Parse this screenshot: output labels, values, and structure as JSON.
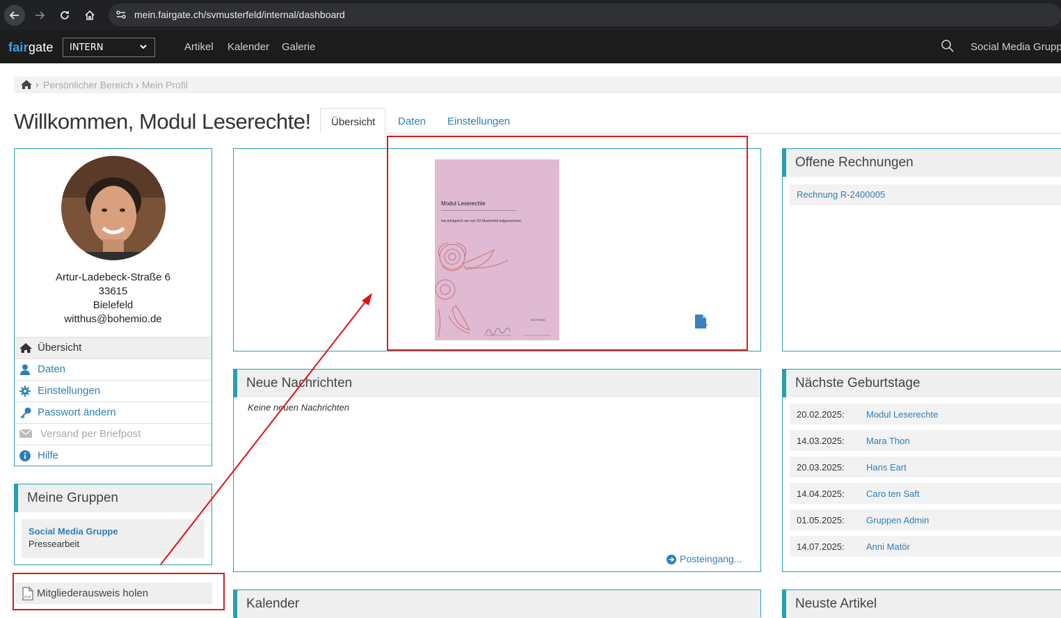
{
  "browser": {
    "url": "mein.fairgate.ch/svmusterfeld/internal/dashboard"
  },
  "nav": {
    "logo_a": "fair",
    "logo_b": "gate",
    "area_select": "INTERN",
    "menu": [
      "Artikel",
      "Kalender",
      "Galerie"
    ],
    "group_label": "Social Media Gruppe"
  },
  "breadcrumb": [
    "Persönlicher Bereich",
    "Mein Profil"
  ],
  "page": {
    "title": "Willkommen, Modul Leserechte!",
    "tabs": [
      "Übersicht",
      "Daten",
      "Einstellungen"
    ]
  },
  "profile": {
    "street": "Artur-Ladebeck-Straße 6",
    "zip": "33615",
    "city": "Bielefeld",
    "email": "witthus@bohemio.de",
    "menu": [
      {
        "label": "Übersicht",
        "icon": "home-icon"
      },
      {
        "label": "Daten",
        "icon": "user-icon"
      },
      {
        "label": "Einstellungen",
        "icon": "gear-icon"
      },
      {
        "label": "Passwort ändern",
        "icon": "key-icon"
      },
      {
        "label": "Versand per Briefpost",
        "icon": "envelope-icon"
      },
      {
        "label": "Hilfe",
        "icon": "info-icon"
      }
    ]
  },
  "groups": {
    "title": "Meine Gruppen",
    "items": [
      {
        "name": "Social Media Gruppe",
        "role": "Pressearbeit"
      }
    ]
  },
  "membership_card_button": "Mitgliederausweis holen",
  "certificate": {
    "name": "Modul Leserechte",
    "text": "hat erfolgreich am    von SV Musterfeld teilgenommen.",
    "date": "25.07.2024"
  },
  "messages": {
    "title": "Neue Nachrichten",
    "empty": "Keine neuen Nachrichten",
    "inbox_link": "Posteingang..."
  },
  "calendar": {
    "title": "Kalender"
  },
  "invoices": {
    "title": "Offene Rechnungen",
    "items": [
      "Rechnung R-2400005"
    ]
  },
  "birthdays": {
    "title": "Nächste Geburtstage",
    "items": [
      {
        "date": "20.02.2025:",
        "name": "Modul Leserechte"
      },
      {
        "date": "14.03.2025:",
        "name": "Mara Thon"
      },
      {
        "date": "20.03.2025:",
        "name": "Hans Eart"
      },
      {
        "date": "14.04.2025:",
        "name": "Caro ten Saft"
      },
      {
        "date": "01.05.2025:",
        "name": "Gruppen Admin"
      },
      {
        "date": "14.07.2025:",
        "name": "Anni Matör"
      }
    ]
  },
  "articles": {
    "title": "Neuste Artikel"
  },
  "colors": {
    "accent": "#27a0ab",
    "link": "#2e7fb8",
    "annotation": "#d81b1b"
  }
}
